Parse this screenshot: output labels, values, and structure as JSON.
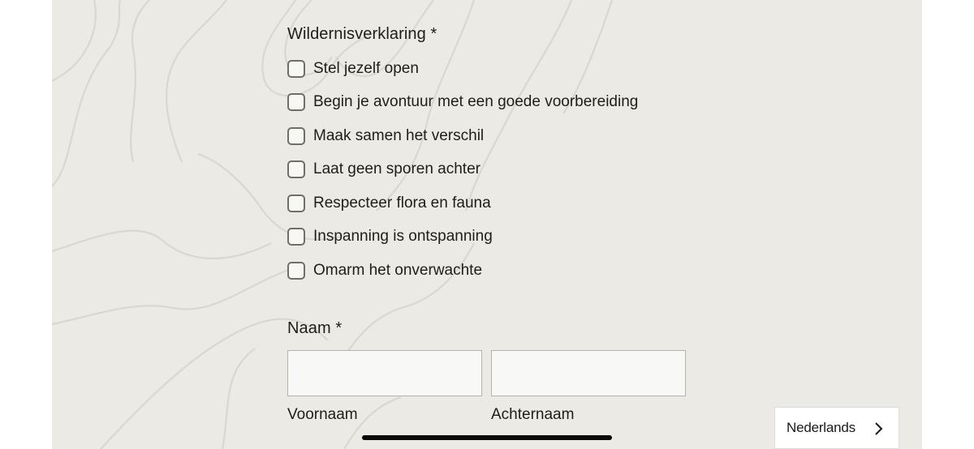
{
  "declaration": {
    "label": "Wildernisverklaring *",
    "options": [
      {
        "label": "Stel jezelf open",
        "checked": false
      },
      {
        "label": "Begin je avontuur met een goede voorbereiding",
        "checked": false
      },
      {
        "label": "Maak samen het verschil",
        "checked": false
      },
      {
        "label": "Laat geen sporen achter",
        "checked": false
      },
      {
        "label": "Respecteer flora en fauna",
        "checked": false
      },
      {
        "label": "Inspanning is ontspanning",
        "checked": false
      },
      {
        "label": "Omarm het onverwachte",
        "checked": false
      }
    ]
  },
  "name": {
    "label": "Naam *",
    "first": {
      "value": "",
      "sublabel": "Voornaam"
    },
    "last": {
      "value": "",
      "sublabel": "Achternaam"
    }
  },
  "language": {
    "label": "Nederlands",
    "icon": "chevron-right-icon"
  },
  "colors": {
    "background": "#ebeae4",
    "contour_lines": "#d9d8cf",
    "text": "#1d1d1b"
  }
}
